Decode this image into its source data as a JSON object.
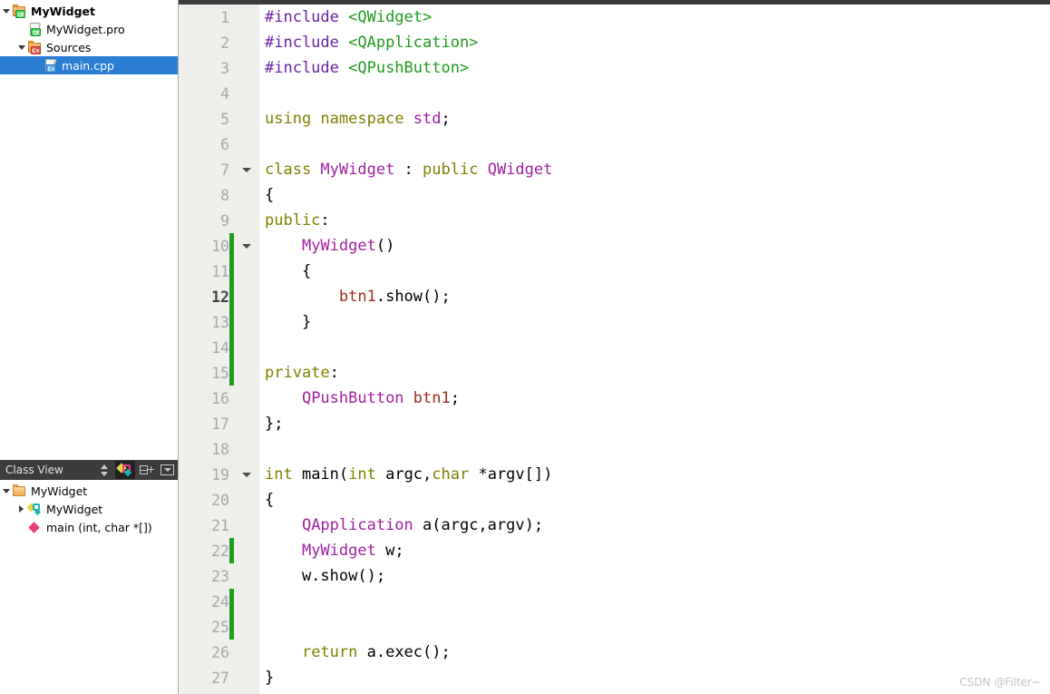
{
  "sidebar": {
    "project_tree": [
      {
        "label": "MyWidget",
        "icon": "qt-project-folder-icon",
        "indent": 0,
        "twisty": "down",
        "bold": true,
        "selected": false,
        "name": "tree-item-mywidget-project"
      },
      {
        "label": "MyWidget.pro",
        "icon": "qt-pro-file-icon",
        "indent": 1,
        "twisty": "none",
        "bold": false,
        "selected": false,
        "name": "tree-item-mywidget-pro"
      },
      {
        "label": "Sources",
        "icon": "cpp-sources-folder-icon",
        "indent": 1,
        "twisty": "down",
        "bold": false,
        "selected": false,
        "name": "tree-item-sources"
      },
      {
        "label": "main.cpp",
        "icon": "cpp-file-icon",
        "indent": 2,
        "twisty": "none",
        "bold": false,
        "selected": true,
        "name": "tree-item-main-cpp"
      }
    ],
    "class_view": {
      "title": "Class View",
      "toolbar": [
        {
          "icon": "sort-up-down-icon",
          "active": false,
          "name": "classview-sort-button"
        },
        {
          "icon": "sort-by-class-icon",
          "active": true,
          "name": "classview-sort-by-class-button"
        },
        {
          "icon": "split-add-icon",
          "active": false,
          "name": "classview-split-button"
        },
        {
          "icon": "dropdown-menu-icon",
          "active": false,
          "name": "classview-menu-button"
        }
      ],
      "items": [
        {
          "label": "MyWidget",
          "icon": "folder-icon",
          "indent": 0,
          "twisty": "down",
          "name": "classview-item-mywidget-root"
        },
        {
          "label": "MyWidget",
          "icon": "class-icon",
          "indent": 1,
          "twisty": "right",
          "name": "classview-item-mywidget-class"
        },
        {
          "label": "main (int, char *[])",
          "icon": "function-icon",
          "indent": 1,
          "twisty": "none",
          "name": "classview-item-main-function"
        }
      ]
    }
  },
  "editor": {
    "current_line": 12,
    "colors": {
      "preprocessor": "#6b21a8",
      "include_path": "#1f9b1f",
      "keyword": "#808000",
      "type": "#a020a0",
      "member": "#9e2b20",
      "gutter_bg": "#eeeeea",
      "change_bar": "#1b9e1b",
      "selection": "#2b7cd3"
    },
    "lines": [
      {
        "n": "1",
        "fold": false,
        "chg": false,
        "tokens": [
          {
            "t": "#include ",
            "c": "pre"
          },
          {
            "t": "<QWidget>",
            "c": "inc"
          }
        ]
      },
      {
        "n": "2",
        "fold": false,
        "chg": false,
        "tokens": [
          {
            "t": "#include ",
            "c": "pre"
          },
          {
            "t": "<QApplication>",
            "c": "inc"
          }
        ]
      },
      {
        "n": "3",
        "fold": false,
        "chg": false,
        "tokens": [
          {
            "t": "#include ",
            "c": "pre"
          },
          {
            "t": "<QPushButton>",
            "c": "inc"
          }
        ]
      },
      {
        "n": "4",
        "fold": false,
        "chg": false,
        "tokens": []
      },
      {
        "n": "5",
        "fold": false,
        "chg": false,
        "tokens": [
          {
            "t": "using namespace ",
            "c": "kw"
          },
          {
            "t": "std",
            "c": "type"
          },
          {
            "t": ";",
            "c": "plain"
          }
        ]
      },
      {
        "n": "6",
        "fold": false,
        "chg": false,
        "tokens": []
      },
      {
        "n": "7",
        "fold": true,
        "chg": false,
        "tokens": [
          {
            "t": "class ",
            "c": "kw"
          },
          {
            "t": "MyWidget",
            "c": "type"
          },
          {
            "t": " : ",
            "c": "plain"
          },
          {
            "t": "public",
            "c": "kw"
          },
          {
            "t": " ",
            "c": "plain"
          },
          {
            "t": "QWidget",
            "c": "type"
          }
        ]
      },
      {
        "n": "8",
        "fold": false,
        "chg": false,
        "tokens": [
          {
            "t": "{",
            "c": "plain"
          }
        ]
      },
      {
        "n": "9",
        "fold": false,
        "chg": false,
        "tokens": [
          {
            "t": "public",
            "c": "kw"
          },
          {
            "t": ":",
            "c": "plain"
          }
        ]
      },
      {
        "n": "10",
        "fold": true,
        "chg": true,
        "tokens": [
          {
            "t": "    ",
            "c": "plain"
          },
          {
            "t": "MyWidget",
            "c": "type"
          },
          {
            "t": "()",
            "c": "plain"
          }
        ]
      },
      {
        "n": "11",
        "fold": false,
        "chg": true,
        "tokens": [
          {
            "t": "    {",
            "c": "plain"
          }
        ]
      },
      {
        "n": "12",
        "fold": false,
        "chg": true,
        "current": true,
        "tokens": [
          {
            "t": "        ",
            "c": "plain"
          },
          {
            "t": "btn1",
            "c": "member"
          },
          {
            "t": ".show();",
            "c": "plain"
          }
        ]
      },
      {
        "n": "13",
        "fold": false,
        "chg": true,
        "tokens": [
          {
            "t": "    }",
            "c": "plain"
          }
        ]
      },
      {
        "n": "14",
        "fold": false,
        "chg": true,
        "tokens": []
      },
      {
        "n": "15",
        "fold": false,
        "chg": true,
        "tokens": [
          {
            "t": "private",
            "c": "kw"
          },
          {
            "t": ":",
            "c": "plain"
          }
        ]
      },
      {
        "n": "16",
        "fold": false,
        "chg": false,
        "tokens": [
          {
            "t": "    ",
            "c": "plain"
          },
          {
            "t": "QPushButton",
            "c": "type"
          },
          {
            "t": " ",
            "c": "plain"
          },
          {
            "t": "btn1",
            "c": "member"
          },
          {
            "t": ";",
            "c": "plain"
          }
        ]
      },
      {
        "n": "17",
        "fold": false,
        "chg": false,
        "tokens": [
          {
            "t": "};",
            "c": "plain"
          }
        ]
      },
      {
        "n": "18",
        "fold": false,
        "chg": false,
        "tokens": []
      },
      {
        "n": "19",
        "fold": true,
        "chg": false,
        "tokens": [
          {
            "t": "int",
            "c": "kw"
          },
          {
            "t": " main(",
            "c": "plain"
          },
          {
            "t": "int",
            "c": "kw"
          },
          {
            "t": " argc,",
            "c": "plain"
          },
          {
            "t": "char",
            "c": "kw"
          },
          {
            "t": " *argv[])",
            "c": "plain"
          }
        ]
      },
      {
        "n": "20",
        "fold": false,
        "chg": false,
        "tokens": [
          {
            "t": "{",
            "c": "plain"
          }
        ]
      },
      {
        "n": "21",
        "fold": false,
        "chg": false,
        "tokens": [
          {
            "t": "    ",
            "c": "plain"
          },
          {
            "t": "QApplication",
            "c": "type"
          },
          {
            "t": " a(argc,argv);",
            "c": "plain"
          }
        ]
      },
      {
        "n": "22",
        "fold": false,
        "chg": true,
        "tokens": [
          {
            "t": "    ",
            "c": "plain"
          },
          {
            "t": "MyWidget",
            "c": "type"
          },
          {
            "t": " w;",
            "c": "plain"
          }
        ]
      },
      {
        "n": "23",
        "fold": false,
        "chg": false,
        "tokens": [
          {
            "t": "    w.show();",
            "c": "plain"
          }
        ]
      },
      {
        "n": "24",
        "fold": false,
        "chg": true,
        "tokens": []
      },
      {
        "n": "25",
        "fold": false,
        "chg": true,
        "tokens": []
      },
      {
        "n": "26",
        "fold": false,
        "chg": false,
        "tokens": [
          {
            "t": "    ",
            "c": "plain"
          },
          {
            "t": "return",
            "c": "kw"
          },
          {
            "t": " a.exec();",
            "c": "plain"
          }
        ]
      },
      {
        "n": "27",
        "fold": false,
        "chg": false,
        "tokens": [
          {
            "t": "}",
            "c": "plain"
          }
        ]
      }
    ]
  },
  "watermark": "CSDN @Filter~"
}
